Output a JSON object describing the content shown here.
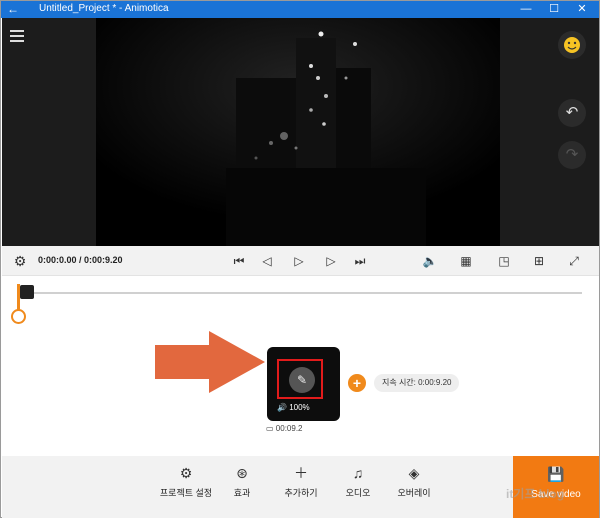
{
  "window": {
    "title": "Untitled_Project * - Animotica",
    "back_glyph": "←",
    "minimize_glyph": "—",
    "maximize_glyph": "☐",
    "close_glyph": "✕"
  },
  "player": {
    "current_time": "0:00:0.00 / 0:00:9.20"
  },
  "clip": {
    "volume": "100%",
    "duration": "00:09.2"
  },
  "duration_pill": "지속 시간: 0:00:9.20",
  "toolbar": {
    "project_settings": "프로젝트 설정",
    "effects": "효과",
    "add": "추가하기",
    "audio": "오디오",
    "overlay": "오버레이",
    "save": "Save video"
  },
  "watermark": "it기프 blog",
  "colors": {
    "titlebar": "#1a73d6",
    "accent": "#f08a1c",
    "highlight": "#e21b1b"
  },
  "icons": [
    "back-arrow-icon",
    "hamburger-menu-icon",
    "emoji-icon",
    "undo-icon",
    "redo-icon",
    "settings-icon",
    "skip-start-icon",
    "step-back-icon",
    "play-icon",
    "step-forward-icon",
    "skip-end-icon",
    "volume-icon",
    "pattern-icon",
    "crop-icon",
    "grid-icon",
    "fullscreen-icon",
    "pencil-icon",
    "speaker-icon",
    "camera-icon",
    "plus-icon",
    "gear-icon",
    "effects-icon",
    "music-icon",
    "layers-icon",
    "save-icon"
  ]
}
